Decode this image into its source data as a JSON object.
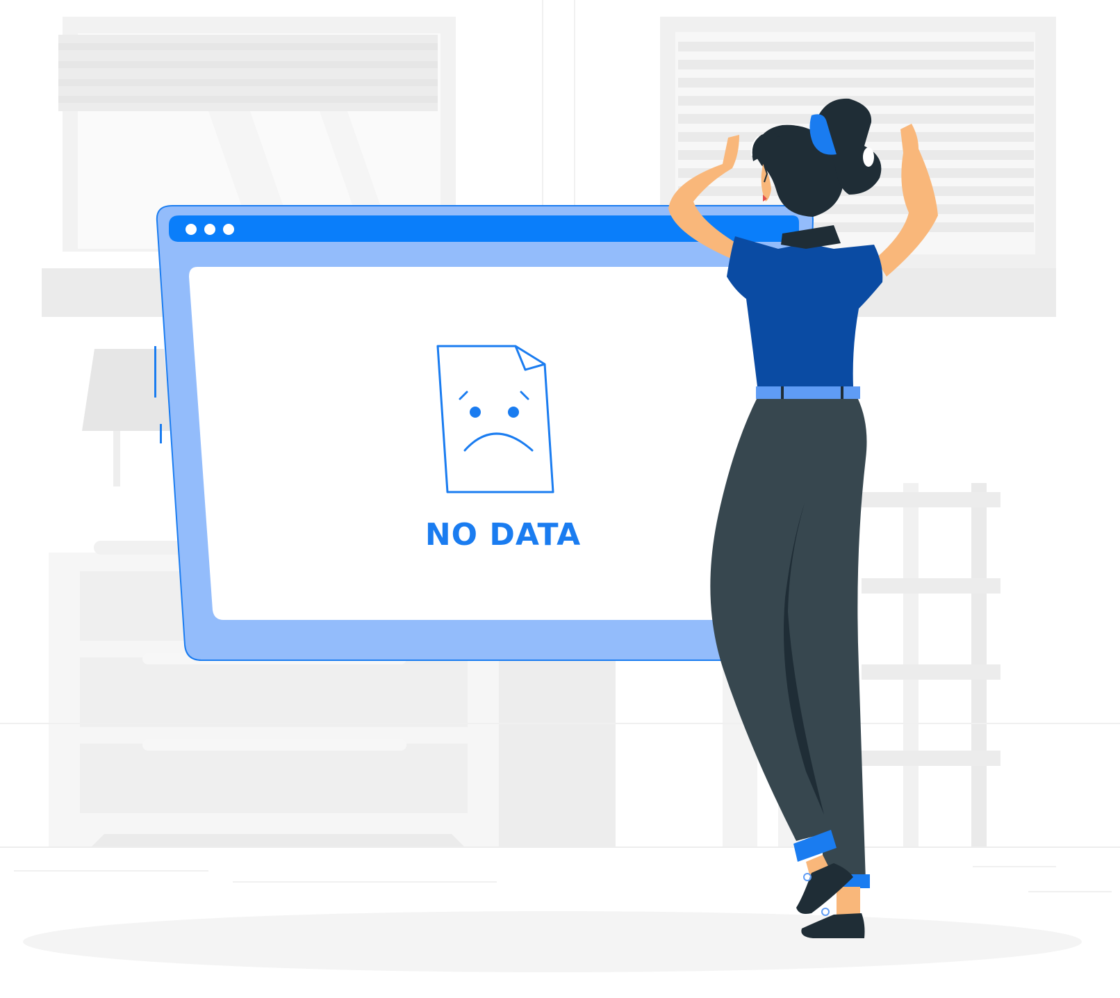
{
  "message": {
    "text": "NO DATA"
  },
  "colors": {
    "browser_frame": "#93BCFB",
    "browser_header": "#0A7EFA",
    "accent_blue": "#1A7CF0",
    "shirt": "#0A4BA3",
    "trousers": "#37474F",
    "hair": "#1F2D36",
    "skin": "#F9B77A",
    "background_gray": "#EFEFEF"
  },
  "icons": {
    "window_dots": "three-dots-icon",
    "document": "sad-document-icon"
  }
}
